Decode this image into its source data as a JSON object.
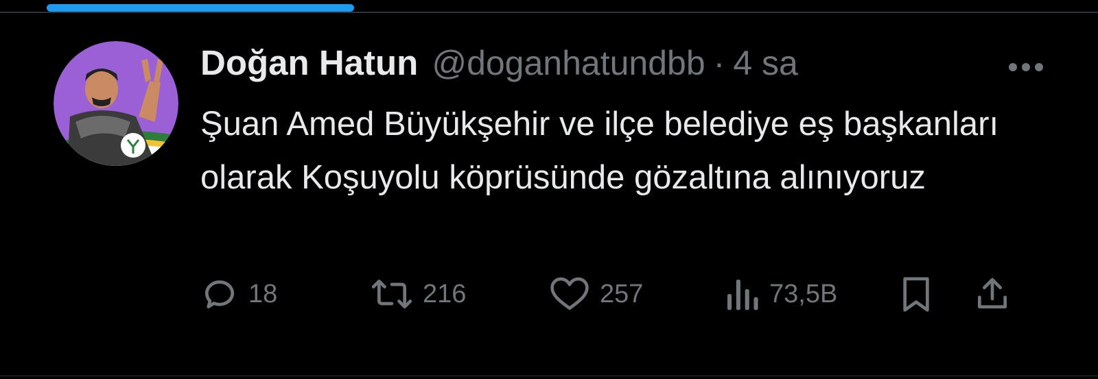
{
  "progress": {
    "fraction": 0.28
  },
  "tweet": {
    "author": {
      "name": "Doğan Hatun",
      "handle": "@doganhatundbb",
      "avatar_icon": "profile-photo"
    },
    "separator": "·",
    "time": "4 sa",
    "text": "Şuan Amed Büyükşehir ve ilçe belediye eş başkanları olarak Koşuyolu köprüsünde gözaltına alınıyoruz",
    "actions": {
      "reply": {
        "icon": "reply-icon",
        "count": "18"
      },
      "retweet": {
        "icon": "retweet-icon",
        "count": "216"
      },
      "like": {
        "icon": "heart-icon",
        "count": "257"
      },
      "views": {
        "icon": "views-chart-icon",
        "count": "73,5B"
      },
      "bookmark": {
        "icon": "bookmark-icon"
      },
      "share": {
        "icon": "share-icon"
      }
    }
  },
  "colors": {
    "background": "#000000",
    "text_primary": "#e7e9ea",
    "text_secondary": "#71767b",
    "accent": "#1d9bf0",
    "avatar_bg": "#9b5fd6"
  }
}
